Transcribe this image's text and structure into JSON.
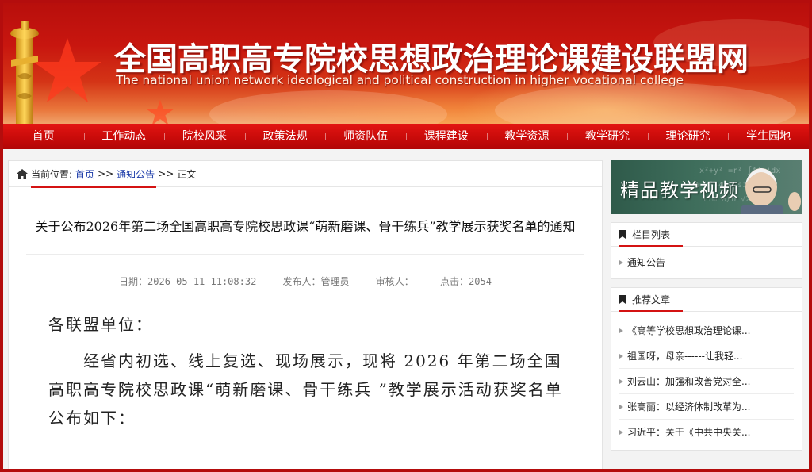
{
  "site": {
    "title": "全国高职高专院校思想政治理论课建设联盟网",
    "subtitle": "The national union network ideological and political construction in higher vocational college"
  },
  "nav": {
    "items": [
      "首页",
      "工作动态",
      "院校风采",
      "政策法规",
      "师资队伍",
      "课程建设",
      "教学资源",
      "教学研究",
      "理论研究",
      "学生园地"
    ]
  },
  "breadcrumb": {
    "prefix": "当前位置:",
    "home": "首页",
    "sep1": ">>",
    "section": "通知公告",
    "sep2": ">>",
    "current": "正文"
  },
  "article": {
    "title": "关于公布2026年第二场全国高职高专院校思政课“萌新磨课、骨干练兵”教学展示获奖名单的通知",
    "meta": {
      "date": "日期：2026-05-11 11:08:32",
      "publisher": "发布人：管理员",
      "reviewer": "审核人：",
      "clicks": "点击：2054"
    },
    "salutation": "各联盟单位：",
    "paragraph": "经省内初选、线上复选、现场展示，现将 2026 年第二场全国高职高专院校思政课“萌新磨课、骨干练兵 ”教学展示活动获奖名单公布如下："
  },
  "sidebar": {
    "video_banner": "精品教学视频",
    "column_list": {
      "heading": "栏目列表",
      "items": [
        "通知公告"
      ]
    },
    "recommended": {
      "heading": "推荐文章",
      "items": [
        "《高等学校思想政治理论课...",
        "祖国呀，母亲------让我轻...",
        "刘云山：加强和改善党对全...",
        "张高丽：以经济体制改革为...",
        "习近平：关于《中共中央关..."
      ]
    }
  },
  "colors": {
    "frame": "#b40d0d",
    "nav": "#c90b0a",
    "accent": "#d41313",
    "link": "#1a3aa8"
  }
}
